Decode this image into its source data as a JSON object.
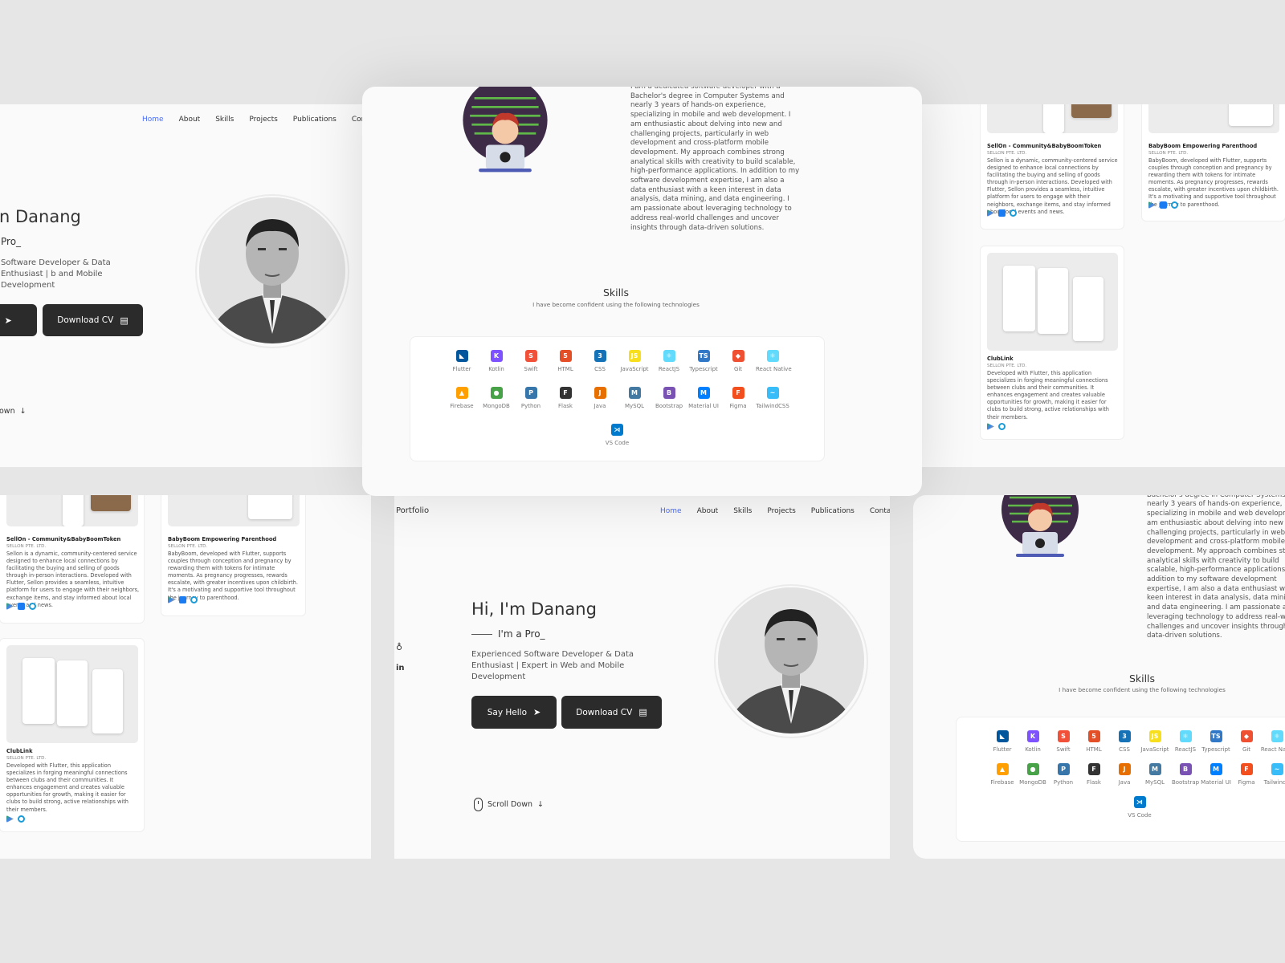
{
  "colors": {
    "background": "#e6e6e6",
    "panel": "#fafafa",
    "accent": "#4a6cf7",
    "button": "#2b2b2b"
  },
  "nav": {
    "brand": "Portfolio",
    "items": [
      "Home",
      "About",
      "Skills",
      "Projects",
      "Publications",
      "Contact"
    ],
    "active": "Home"
  },
  "nav_cropped": {
    "items": [
      "Home",
      "About",
      "Skills",
      "Projects",
      "Publications",
      "Cont"
    ]
  },
  "nav_cropped_b": {
    "contact": "Contac"
  },
  "hero": {
    "greeting": "Hi, I'm Danang",
    "greeting_cropped": "n Danang",
    "role": "I'm a Pro_",
    "role_cropped": "Pro_",
    "description": "Experienced Software Developer & Data Enthusiast | Expert in Web and Mobile Development",
    "description_cropped": "Software Developer & Data Enthusiast | b and Mobile Development",
    "say_hello": "Say Hello",
    "say_hello_cropped": "o",
    "download_cv": "Download CV",
    "scroll_down": "Scroll Down",
    "scroll_down_cropped": "own",
    "icons": {
      "send": "send-icon",
      "document": "document-icon",
      "arrow": "arrow-down-icon",
      "github": "github-icon",
      "linkedin": "linkedin-icon"
    }
  },
  "about": {
    "text": "I am a dedicated software developer with a Bachelor's degree in Computer Systems and nearly 3 years of hands-on experience, specializing in mobile and web development. I am enthusiastic about delving into new and challenging projects, particularly in web development and cross-platform mobile development. My approach combines strong analytical skills with creativity to build scalable, high-performance applications. In addition to my software development expertise, I am also a data enthusiast with a keen interest in data analysis, data mining, and data engineering. I am passionate about leveraging technology to address real-world challenges and uncover insights through data-driven solutions."
  },
  "skills": {
    "title": "Skills",
    "subtitle": "I have become confident using the following technologies",
    "items": [
      {
        "label": "Flutter",
        "color": "#02569b",
        "glyph": "◣"
      },
      {
        "label": "Kotlin",
        "color": "#7f52ff",
        "glyph": "K"
      },
      {
        "label": "Swift",
        "color": "#f05138",
        "glyph": "S"
      },
      {
        "label": "HTML",
        "color": "#e34f26",
        "glyph": "5"
      },
      {
        "label": "CSS",
        "color": "#1572b6",
        "glyph": "3"
      },
      {
        "label": "JavaScript",
        "color": "#f7df1e",
        "glyph": "JS"
      },
      {
        "label": "ReactJS",
        "color": "#61dafb",
        "glyph": "⚛"
      },
      {
        "label": "Typescript",
        "color": "#3178c6",
        "glyph": "TS"
      },
      {
        "label": "Git",
        "color": "#f05032",
        "glyph": "◆"
      },
      {
        "label": "React Native",
        "color": "#61dafb",
        "glyph": "⚛"
      },
      {
        "label": "Firebase",
        "color": "#ffa000",
        "glyph": "▲"
      },
      {
        "label": "MongoDB",
        "color": "#47a248",
        "glyph": "●"
      },
      {
        "label": "Python",
        "color": "#3776ab",
        "glyph": "P"
      },
      {
        "label": "Flask",
        "color": "#333333",
        "glyph": "F"
      },
      {
        "label": "Java",
        "color": "#e76f00",
        "glyph": "J"
      },
      {
        "label": "MySQL",
        "color": "#4479a1",
        "glyph": "M"
      },
      {
        "label": "Bootstrap",
        "color": "#7952b3",
        "glyph": "B"
      },
      {
        "label": "Material UI",
        "color": "#007fff",
        "glyph": "M"
      },
      {
        "label": "Figma",
        "color": "#f24e1e",
        "glyph": "F"
      },
      {
        "label": "TailwindCSS",
        "color": "#38bdf8",
        "glyph": "~"
      },
      {
        "label": "VS Code",
        "color": "#007acc",
        "glyph": "⋊"
      }
    ],
    "cropped_labels": {
      "react_native": "React Nativ",
      "tailwind": "TailwindC"
    }
  },
  "projects": [
    {
      "title": "SellOn - Community&BabyBoomToken",
      "company": "SELLON PTE. LTD.",
      "description": "Sellon is a dynamic, community-centered service designed to enhance local connections by facilitating the buying and selling of goods through in-person interactions. Developed with Flutter, Sellon provides a seamless, intuitive platform for users to engage with their neighbors, exchange items, and stay informed about local events and news.",
      "links": [
        "play-store-icon",
        "app-store-icon",
        "web-icon"
      ]
    },
    {
      "title": "BabyBoom Empowering Parenthood",
      "company": "SELLON PTE. LTD.",
      "description": "BabyBoom, developed with Flutter, supports couples through conception and pregnancy by rewarding them with tokens for intimate moments. As pregnancy progresses, rewards escalate, with greater incentives upon childbirth. It's a motivating and supportive tool throughout the journey to parenthood.",
      "links": [
        "play-store-icon",
        "app-store-icon",
        "web-icon"
      ]
    },
    {
      "title": "ClubLink",
      "company": "SELLON PTE. LTD.",
      "description": "Developed with Flutter, this application specializes in forging meaningful connections between clubs and their communities. It enhances engagement and creates valuable opportunities for growth, making it easier for clubs to build strong, active relationships with their members.",
      "links": [
        "play-store-icon",
        "web-icon"
      ]
    }
  ]
}
